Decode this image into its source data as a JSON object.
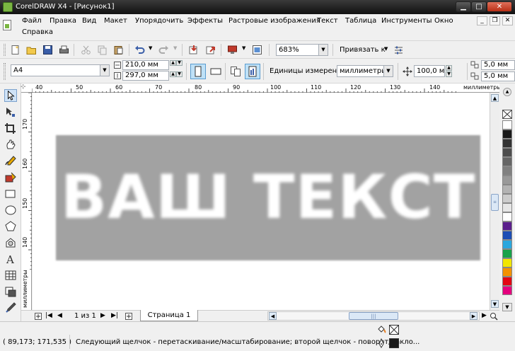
{
  "window": {
    "title": "CorelDRAW X4 - [Рисунок1]",
    "min_label": "▁",
    "max_label": "□",
    "close_label": "✕"
  },
  "menu": {
    "items": [
      "Файл",
      "Правка",
      "Вид",
      "Макет",
      "Упорядочить",
      "Эффекты",
      "Растровые изображения",
      "Текст",
      "Таблица",
      "Инструменты",
      "Окно"
    ],
    "second_row": "Справка",
    "mdi_min": "_",
    "mdi_restore": "❐",
    "mdi_close": "✕"
  },
  "standard_toolbar": {
    "zoom_value": "683%",
    "snap_label": "Привязать к"
  },
  "property_bar": {
    "page_size": "A4",
    "width_value": "210,0 мм",
    "height_value": "297,0 мм",
    "units_label": "Единицы измерения:",
    "units_value": "миллиметры",
    "nudge_value": "100,0 мм",
    "dup_x_value": "5,0 мм",
    "dup_y_value": "5,0 мм"
  },
  "rulers": {
    "top_ticks": [
      "40",
      "50",
      "60",
      "70",
      "80",
      "90",
      "100",
      "110",
      "120",
      "130",
      "140"
    ],
    "top_unit": "миллиметры",
    "left_ticks": [
      "170",
      "160",
      "150",
      "140"
    ],
    "left_unit": "миллиметры"
  },
  "canvas": {
    "text": "ВАШ ТЕКСТ"
  },
  "page_nav": {
    "counter": "1 из 1",
    "page_tab": "Страница 1"
  },
  "status": {
    "coords": "( 89,173; 171,535 )",
    "hint": "Следующий щелчок - перетаскивание/масштабирование; второй щелчок - поворот/накло..."
  },
  "palette_colors": [
    "#ffffff",
    "#1a1a1a",
    "#333333",
    "#4d4d4d",
    "#666666",
    "#808080",
    "#999999",
    "#b3b3b3",
    "#cccccc",
    "#e6e6e6",
    "#ffffff",
    "#5b1f8c",
    "#1c4db5",
    "#2aa7de",
    "#17a24a",
    "#f1e600",
    "#f39200",
    "#e30613",
    "#e5007e"
  ]
}
